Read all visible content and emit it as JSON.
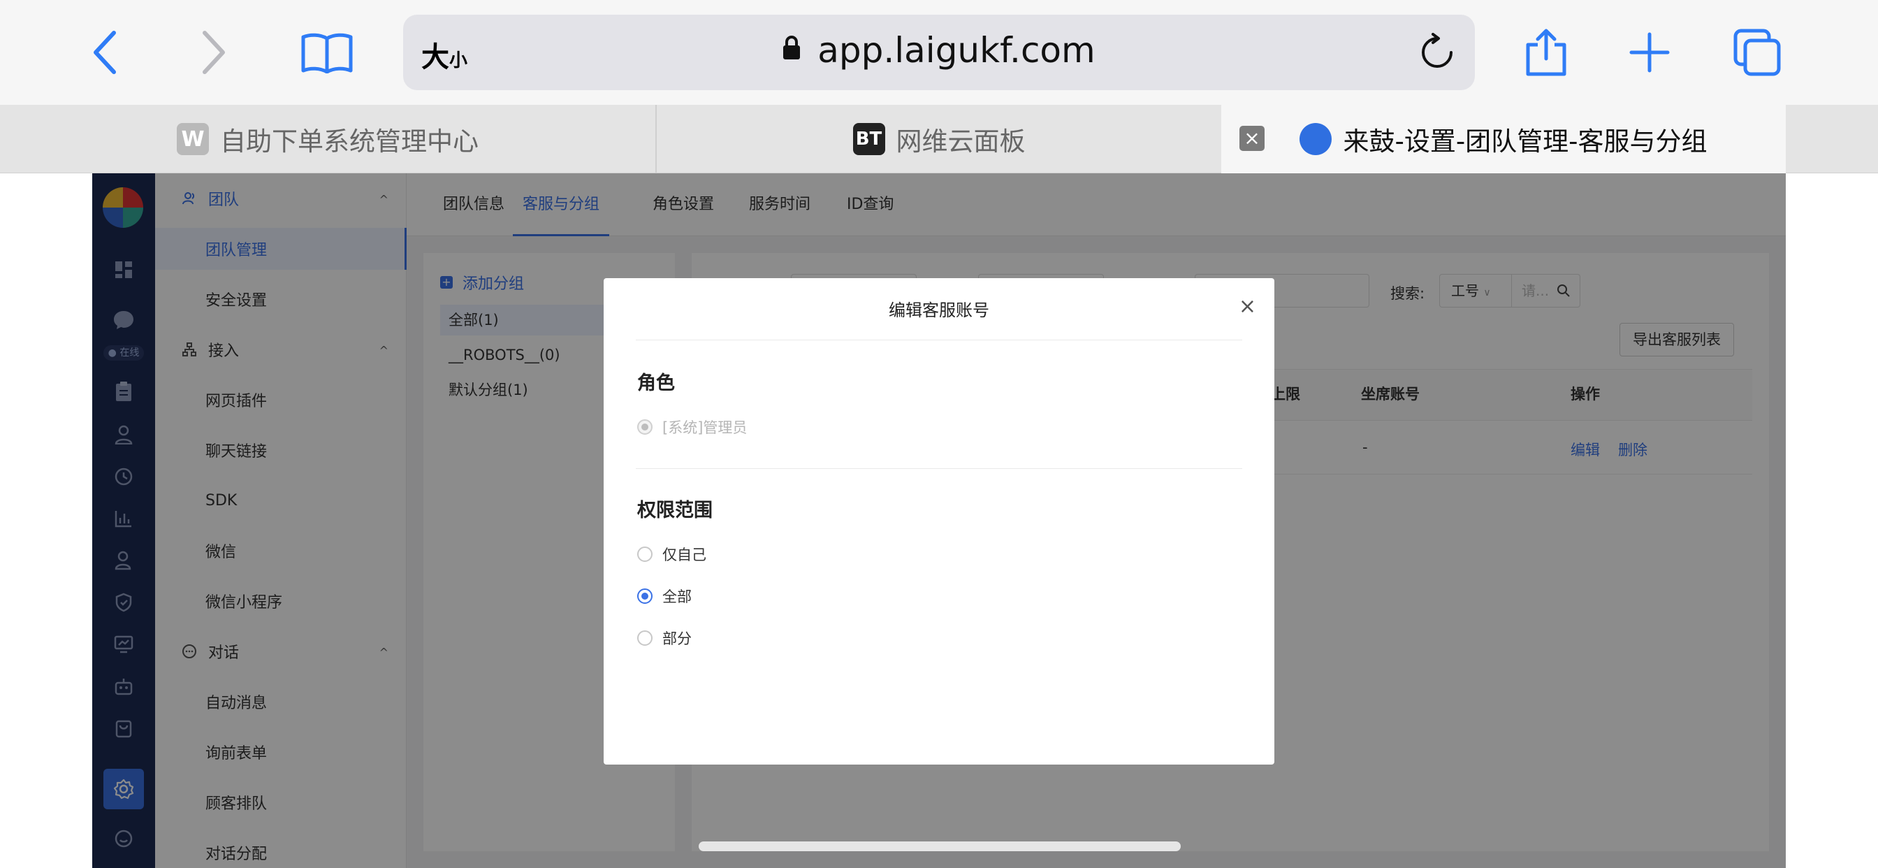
{
  "browser": {
    "text_size_label": "大",
    "text_size_small": "小",
    "url": "app.laigukf.com"
  },
  "browser_tabs": [
    {
      "favicon": "W",
      "favicon_color": "#b9b9b9",
      "title": "自助下单系统管理中心"
    },
    {
      "favicon": "BT",
      "favicon_color": "#222222",
      "title": "网维云面板"
    },
    {
      "favicon": "",
      "favicon_color": "#2f6fe0",
      "title": "来鼓-设置-团队管理-客服与分组",
      "active": true
    }
  ],
  "rail": {
    "online_label": "● 在线"
  },
  "sidebar": {
    "groups": [
      {
        "label": "团队",
        "items": [
          "团队管理",
          "安全设置"
        ]
      },
      {
        "label": "接入",
        "items": [
          "网页插件",
          "聊天链接",
          "SDK",
          "微信",
          "微信小程序"
        ]
      },
      {
        "label": "对话",
        "items": [
          "自动消息",
          "询前表单",
          "顾客排队",
          "对话分配"
        ]
      }
    ],
    "caret": "^"
  },
  "main_tabs": [
    "团队信息",
    "客服与分组",
    "角色设置",
    "服务时间",
    "ID查询"
  ],
  "groups_panel": {
    "add_label": "添加分组",
    "rows": [
      "全部(1)",
      "__ROBOTS__(0)",
      "默认分组(1)"
    ]
  },
  "filters": {
    "search_label": "搜索:",
    "search_field": "工号",
    "search_placeholder": "请..."
  },
  "export_button": "导出客服列表",
  "table": {
    "headers": {
      "limit": "务上限",
      "seat": "坐席账号",
      "ops": "操作"
    },
    "row": {
      "seat": "-",
      "edit": "编辑",
      "delete": "删除"
    }
  },
  "modal": {
    "title": "编辑客服账号",
    "close": "×",
    "role_section": "角色",
    "role_option": "[系统]管理员",
    "scope_section": "权限范围",
    "scope_options": [
      "仅自己",
      "全部",
      "部分"
    ],
    "scope_selected": "全部"
  },
  "colors": {
    "accent": "#3b72e6",
    "rail_bg": "#1d2a52"
  }
}
